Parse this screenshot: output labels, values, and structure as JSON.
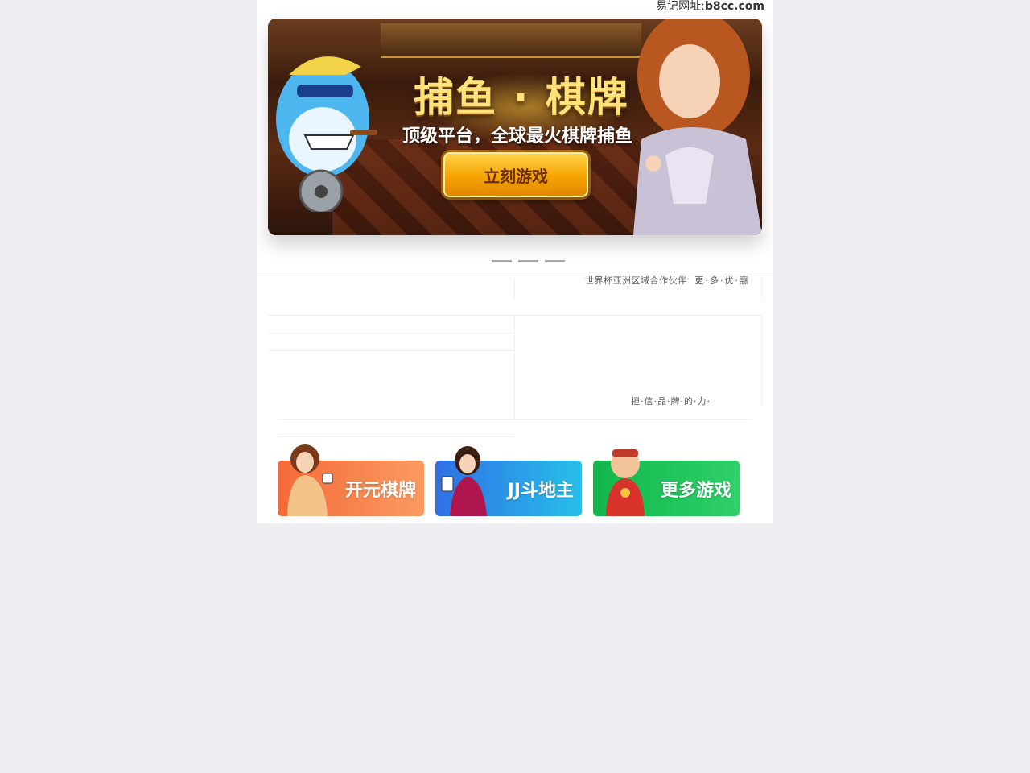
{
  "header": {
    "url_prefix": "易记网址:",
    "url_domain": "b8cc.com"
  },
  "banner": {
    "title": "捕鱼 · 棋牌",
    "subtitle": "顶级平台，全球最火棋牌捕鱼",
    "cta_label": "立刻游戏"
  },
  "carousel": {
    "slide_count": 3
  },
  "promo": {
    "partner_text": "世界杯亚洲区域合作伙伴",
    "more_label": "更·多·优·惠"
  },
  "brand": {
    "slogan": "担·信·品·牌·的·力·"
  },
  "games": [
    {
      "label": "开元棋牌",
      "color": "#f46a38"
    },
    {
      "label": "JJ斗地主",
      "color": "#2f6fe5"
    },
    {
      "label": "更多游戏",
      "color": "#12b54c"
    }
  ]
}
